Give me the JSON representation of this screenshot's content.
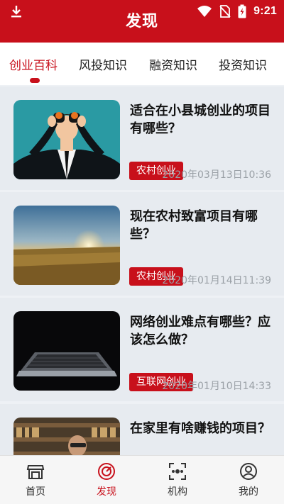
{
  "status_bar": {
    "time": "9:21"
  },
  "header": {
    "title": "发现"
  },
  "tabs": [
    {
      "label": "创业百科",
      "active": true
    },
    {
      "label": "风投知识",
      "active": false
    },
    {
      "label": "融资知识",
      "active": false
    },
    {
      "label": "投资知识",
      "active": false
    }
  ],
  "articles": [
    {
      "title": "适合在小县城创业的项目有哪些？",
      "tag": "农村创业",
      "date": "2020年03月13日10:36",
      "image": "businessman-binoculars"
    },
    {
      "title": "现在农村致富项目有哪些？",
      "tag": "农村创业",
      "date": "2020年01月14日11:39",
      "image": "sunset-field"
    },
    {
      "title": "网络创业难点有哪些？应该怎么做？",
      "tag": "互联网创业",
      "date": "2020年01月10日14:33",
      "image": "laptop-dark"
    },
    {
      "title": "在家里有啥赚钱的项目？",
      "tag": "",
      "date": "",
      "image": "man-reading-library"
    }
  ],
  "bottom_nav": [
    {
      "label": "首页",
      "icon": "store-icon",
      "active": false
    },
    {
      "label": "发现",
      "icon": "compass-icon",
      "active": true
    },
    {
      "label": "机构",
      "icon": "scan-icon",
      "active": false
    },
    {
      "label": "我的",
      "icon": "user-icon",
      "active": false
    }
  ],
  "colors": {
    "brand": "#c8101b",
    "background": "#eef1f5",
    "muted": "#9aa0a6"
  }
}
